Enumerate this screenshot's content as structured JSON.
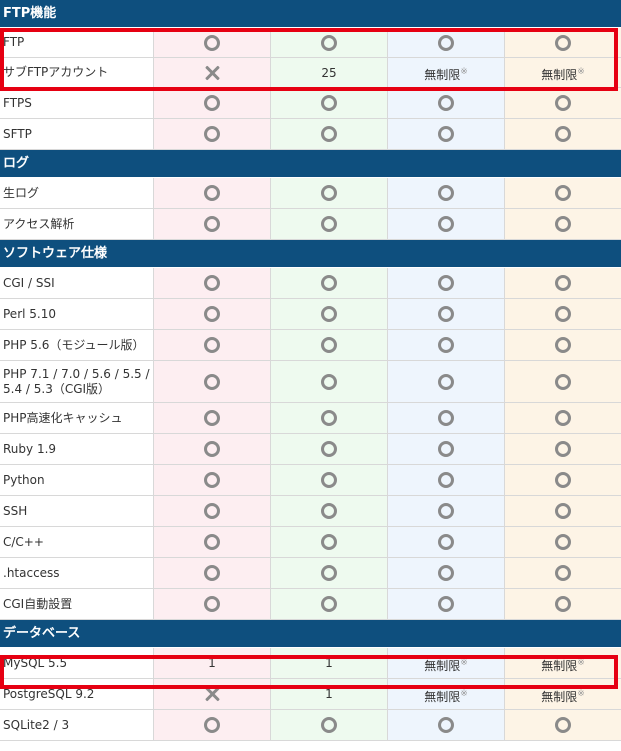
{
  "sections": [
    {
      "title": "FTP機能",
      "rows": [
        {
          "label": "FTP",
          "cells": [
            [
              "circle",
              ""
            ],
            [
              "circle",
              ""
            ],
            [
              "circle",
              ""
            ],
            [
              "circle",
              ""
            ]
          ]
        },
        {
          "label": "サブFTPアカウント",
          "cells": [
            [
              "cross",
              ""
            ],
            [
              "text",
              "25"
            ],
            [
              "unlimited",
              "無制限",
              "※"
            ],
            [
              "unlimited",
              "無制限",
              "※"
            ]
          ]
        },
        {
          "label": "FTPS",
          "cells": [
            [
              "circle",
              ""
            ],
            [
              "circle",
              ""
            ],
            [
              "circle",
              ""
            ],
            [
              "circle",
              ""
            ]
          ]
        },
        {
          "label": "SFTP",
          "cells": [
            [
              "circle",
              ""
            ],
            [
              "circle",
              ""
            ],
            [
              "circle",
              ""
            ],
            [
              "circle",
              ""
            ]
          ]
        }
      ]
    },
    {
      "title": "ログ",
      "rows": [
        {
          "label": "生ログ",
          "cells": [
            [
              "circle",
              ""
            ],
            [
              "circle",
              ""
            ],
            [
              "circle",
              ""
            ],
            [
              "circle",
              ""
            ]
          ]
        },
        {
          "label": "アクセス解析",
          "cells": [
            [
              "circle",
              ""
            ],
            [
              "circle",
              ""
            ],
            [
              "circle",
              ""
            ],
            [
              "circle",
              ""
            ]
          ]
        }
      ]
    },
    {
      "title": "ソフトウェア仕様",
      "rows": [
        {
          "label": "CGI / SSI",
          "cells": [
            [
              "circle",
              ""
            ],
            [
              "circle",
              ""
            ],
            [
              "circle",
              ""
            ],
            [
              "circle",
              ""
            ]
          ]
        },
        {
          "label": "Perl 5.10",
          "cells": [
            [
              "circle",
              ""
            ],
            [
              "circle",
              ""
            ],
            [
              "circle",
              ""
            ],
            [
              "circle",
              ""
            ]
          ]
        },
        {
          "label": "PHP 5.6（モジュール版）",
          "cells": [
            [
              "circle",
              ""
            ],
            [
              "circle",
              ""
            ],
            [
              "circle",
              ""
            ],
            [
              "circle",
              ""
            ]
          ]
        },
        {
          "label": "PHP 7.1 / 7.0 / 5.6 / 5.5 / 5.4 / 5.3（CGI版）",
          "cells": [
            [
              "circle",
              ""
            ],
            [
              "circle",
              ""
            ],
            [
              "circle",
              ""
            ],
            [
              "circle",
              ""
            ]
          ]
        },
        {
          "label": "PHP高速化キャッシュ",
          "cells": [
            [
              "circle",
              ""
            ],
            [
              "circle",
              ""
            ],
            [
              "circle",
              ""
            ],
            [
              "circle",
              ""
            ]
          ]
        },
        {
          "label": "Ruby 1.9",
          "cells": [
            [
              "circle",
              ""
            ],
            [
              "circle",
              ""
            ],
            [
              "circle",
              ""
            ],
            [
              "circle",
              ""
            ]
          ]
        },
        {
          "label": "Python",
          "cells": [
            [
              "circle",
              ""
            ],
            [
              "circle",
              ""
            ],
            [
              "circle",
              ""
            ],
            [
              "circle",
              ""
            ]
          ]
        },
        {
          "label": "SSH",
          "cells": [
            [
              "circle",
              ""
            ],
            [
              "circle",
              ""
            ],
            [
              "circle",
              ""
            ],
            [
              "circle",
              ""
            ]
          ]
        },
        {
          "label": "C/C++",
          "cells": [
            [
              "circle",
              ""
            ],
            [
              "circle",
              ""
            ],
            [
              "circle",
              ""
            ],
            [
              "circle",
              ""
            ]
          ]
        },
        {
          "label": ".htaccess",
          "cells": [
            [
              "circle",
              ""
            ],
            [
              "circle",
              ""
            ],
            [
              "circle",
              ""
            ],
            [
              "circle",
              ""
            ]
          ]
        },
        {
          "label": "CGI自動設置",
          "cells": [
            [
              "circle",
              ""
            ],
            [
              "circle",
              ""
            ],
            [
              "circle",
              ""
            ],
            [
              "circle",
              ""
            ]
          ]
        }
      ]
    },
    {
      "title": "データベース",
      "rows": [
        {
          "label": "MySQL 5.5",
          "cells": [
            [
              "text",
              "1"
            ],
            [
              "text",
              "1"
            ],
            [
              "unlimited",
              "無制限",
              "※"
            ],
            [
              "unlimited",
              "無制限",
              "※"
            ]
          ]
        },
        {
          "label": "PostgreSQL 9.2",
          "cells": [
            [
              "cross",
              ""
            ],
            [
              "text",
              "1"
            ],
            [
              "unlimited",
              "無制限",
              "※"
            ],
            [
              "unlimited",
              "無制限",
              "※"
            ]
          ]
        },
        {
          "label": "SQLite2 / 3",
          "cells": [
            [
              "circle",
              ""
            ],
            [
              "circle",
              ""
            ],
            [
              "circle",
              ""
            ],
            [
              "circle",
              ""
            ]
          ]
        }
      ]
    }
  ],
  "colors": {
    "section_bg": "#0e4f7e",
    "highlight": "#e60012",
    "plan_1_bg": "#fdeef1",
    "plan_2_bg": "#eefaef",
    "plan_3_bg": "#eef5fd",
    "plan_4_bg": "#fdf4e6",
    "mark": "#8a8a8a"
  }
}
